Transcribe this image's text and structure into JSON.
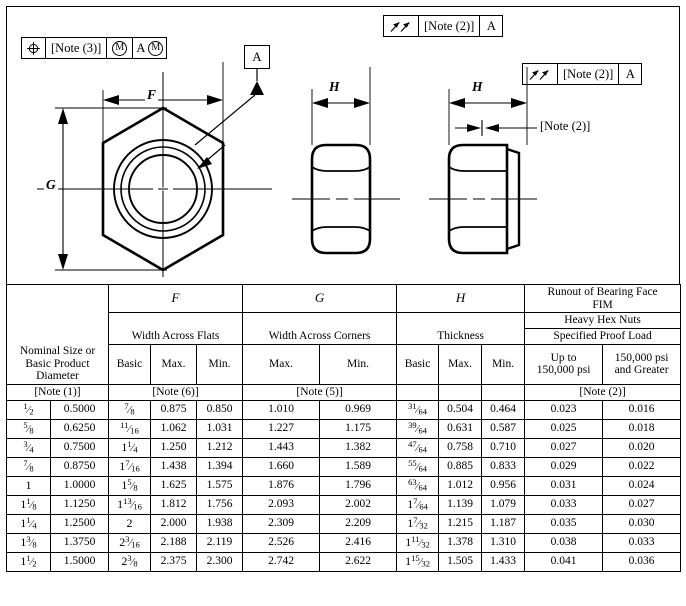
{
  "figure": {
    "drawing": {
      "position_fcf": {
        "symbol_name": "position-symbol",
        "tolerance": "[Note (3)]",
        "mod1": "M",
        "datum": "A",
        "mod2": "M"
      },
      "datum_a_box": "A",
      "runout_fcf_top": {
        "symbol_name": "total-runout-symbol",
        "tolerance": "[Note (2)]",
        "datum": "A"
      },
      "runout_fcf_right": {
        "symbol_name": "total-runout-symbol",
        "tolerance": "[Note (2)]",
        "datum": "A"
      },
      "note2_leader": "[Note (2)]",
      "dim_f": "F",
      "dim_g": "G",
      "dim_h_middle": "H",
      "dim_h_right": "H"
    }
  },
  "table": {
    "headers": {
      "group_f": "F",
      "group_g": "G",
      "group_h": "H",
      "runout_title_line1": "Runout of Bearing Face",
      "runout_title_line2": "FIM",
      "heavy_hex_nuts": "Heavy Hex Nuts",
      "specified_proof_load": "Specified Proof Load",
      "nominal_line1": "Nominal Size or",
      "nominal_line2": "Basic Product",
      "nominal_line3": "Diameter",
      "width_across_flats": "Width Across Flats",
      "width_across_corners": "Width Across Corners",
      "thickness": "Thickness",
      "basic": "Basic",
      "max": "Max.",
      "min": "Min.",
      "proof_low_line1": "Up to",
      "proof_low_line2": "150,000 psi",
      "proof_high_line1": "150,000 psi",
      "proof_high_line2": "and Greater",
      "note1": "[Note (1)]",
      "note6": "[Note (6)]",
      "note5": "[Note (5)]",
      "note2": "[Note (2)]"
    },
    "rows": [
      {
        "nominal_frac": "1/2",
        "nominal_whole": "",
        "nominal_num": "1",
        "nominal_den": "2",
        "basic_diameter": "0.5000",
        "f_basic_whole": "",
        "f_basic_num": "7",
        "f_basic_den": "8",
        "f_max": "0.875",
        "f_min": "0.850",
        "g_max": "1.010",
        "g_min": "0.969",
        "h_basic_whole": "",
        "h_basic_num": "31",
        "h_basic_den": "64",
        "h_max": "0.504",
        "h_min": "0.464",
        "runout_low": "0.023",
        "runout_high": "0.016"
      },
      {
        "nominal_frac": "5/8",
        "nominal_whole": "",
        "nominal_num": "5",
        "nominal_den": "8",
        "basic_diameter": "0.6250",
        "f_basic_whole": "",
        "f_basic_num": "11",
        "f_basic_den": "16",
        "f_max": "1.062",
        "f_min": "1.031",
        "g_max": "1.227",
        "g_min": "1.175",
        "h_basic_whole": "",
        "h_basic_num": "39",
        "h_basic_den": "64",
        "h_max": "0.631",
        "h_min": "0.587",
        "runout_low": "0.025",
        "runout_high": "0.018"
      },
      {
        "nominal_frac": "3/4",
        "nominal_whole": "",
        "nominal_num": "3",
        "nominal_den": "4",
        "basic_diameter": "0.7500",
        "f_basic_whole": "1",
        "f_basic_num": "1",
        "f_basic_den": "4",
        "f_max": "1.250",
        "f_min": "1.212",
        "g_max": "1.443",
        "g_min": "1.382",
        "h_basic_whole": "",
        "h_basic_num": "47",
        "h_basic_den": "64",
        "h_max": "0.758",
        "h_min": "0.710",
        "runout_low": "0.027",
        "runout_high": "0.020"
      },
      {
        "nominal_frac": "7/8",
        "nominal_whole": "",
        "nominal_num": "7",
        "nominal_den": "8",
        "basic_diameter": "0.8750",
        "f_basic_whole": "1",
        "f_basic_num": "7",
        "f_basic_den": "16",
        "f_max": "1.438",
        "f_min": "1.394",
        "g_max": "1.660",
        "g_min": "1.589",
        "h_basic_whole": "",
        "h_basic_num": "55",
        "h_basic_den": "64",
        "h_max": "0.885",
        "h_min": "0.833",
        "runout_low": "0.029",
        "runout_high": "0.022"
      },
      {
        "nominal_frac": "1",
        "nominal_whole": "1",
        "nominal_num": "",
        "nominal_den": "",
        "basic_diameter": "1.0000",
        "f_basic_whole": "1",
        "f_basic_num": "5",
        "f_basic_den": "8",
        "f_max": "1.625",
        "f_min": "1.575",
        "g_max": "1.876",
        "g_min": "1.796",
        "h_basic_whole": "",
        "h_basic_num": "63",
        "h_basic_den": "64",
        "h_max": "1.012",
        "h_min": "0.956",
        "runout_low": "0.031",
        "runout_high": "0.024"
      },
      {
        "nominal_frac": "1 1/8",
        "nominal_whole": "1",
        "nominal_num": "1",
        "nominal_den": "8",
        "basic_diameter": "1.1250",
        "f_basic_whole": "1",
        "f_basic_num": "13",
        "f_basic_den": "16",
        "f_max": "1.812",
        "f_min": "1.756",
        "g_max": "2.093",
        "g_min": "2.002",
        "h_basic_whole": "1",
        "h_basic_num": "7",
        "h_basic_den": "64",
        "h_max": "1.139",
        "h_min": "1.079",
        "runout_low": "0.033",
        "runout_high": "0.027"
      },
      {
        "nominal_frac": "1 1/4",
        "nominal_whole": "1",
        "nominal_num": "1",
        "nominal_den": "4",
        "basic_diameter": "1.2500",
        "f_basic_whole": "2",
        "f_basic_num": "",
        "f_basic_den": "",
        "f_max": "2.000",
        "f_min": "1.938",
        "g_max": "2.309",
        "g_min": "2.209",
        "h_basic_whole": "1",
        "h_basic_num": "7",
        "h_basic_den": "32",
        "h_max": "1.215",
        "h_min": "1.187",
        "runout_low": "0.035",
        "runout_high": "0.030"
      },
      {
        "nominal_frac": "1 3/8",
        "nominal_whole": "1",
        "nominal_num": "3",
        "nominal_den": "8",
        "basic_diameter": "1.3750",
        "f_basic_whole": "2",
        "f_basic_num": "3",
        "f_basic_den": "16",
        "f_max": "2.188",
        "f_min": "2.119",
        "g_max": "2.526",
        "g_min": "2.416",
        "h_basic_whole": "1",
        "h_basic_num": "11",
        "h_basic_den": "32",
        "h_max": "1.378",
        "h_min": "1.310",
        "runout_low": "0.038",
        "runout_high": "0.033"
      },
      {
        "nominal_frac": "1 1/2",
        "nominal_whole": "1",
        "nominal_num": "1",
        "nominal_den": "2",
        "basic_diameter": "1.5000",
        "f_basic_whole": "2",
        "f_basic_num": "3",
        "f_basic_den": "8",
        "f_max": "2.375",
        "f_min": "2.300",
        "g_max": "2.742",
        "g_min": "2.622",
        "h_basic_whole": "1",
        "h_basic_num": "15",
        "h_basic_den": "32",
        "h_max": "1.505",
        "h_min": "1.433",
        "runout_low": "0.041",
        "runout_high": "0.036"
      }
    ]
  }
}
